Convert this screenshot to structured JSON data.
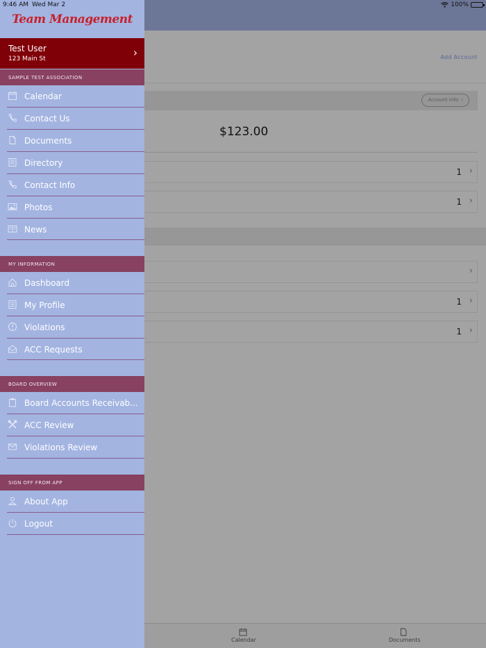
{
  "status_bar": {
    "time": "9:46 AM",
    "date": "Wed Mar 2",
    "battery": "100%"
  },
  "header": {
    "add_account": "Add Account"
  },
  "account_card": {
    "account_info_label": "Account Info",
    "balance": "$123.00"
  },
  "rows": [
    {
      "count": "1"
    },
    {
      "count": "1"
    },
    {
      "count": ""
    },
    {
      "count": "1"
    },
    {
      "count": "1"
    }
  ],
  "tabbar": {
    "tabs": [
      {
        "label": "Calendar",
        "icon": "calendar-icon"
      },
      {
        "label": "Documents",
        "icon": "document-icon"
      }
    ]
  },
  "drawer": {
    "logo": "Team Management",
    "user": {
      "name": "Test User",
      "address": "123 Main St"
    },
    "sections": [
      {
        "title": "SAMPLE TEST ASSOCIATION",
        "items": [
          {
            "label": "Calendar",
            "icon": "calendar-icon"
          },
          {
            "label": "Contact Us",
            "icon": "phone-icon"
          },
          {
            "label": "Documents",
            "icon": "document-icon"
          },
          {
            "label": "Directory",
            "icon": "directory-icon"
          },
          {
            "label": "Contact Info",
            "icon": "phone-icon"
          },
          {
            "label": "Photos",
            "icon": "photos-icon"
          },
          {
            "label": "News",
            "icon": "news-icon"
          }
        ]
      },
      {
        "title": "MY INFORMATION",
        "items": [
          {
            "label": "Dashboard",
            "icon": "home-icon"
          },
          {
            "label": "My Profile",
            "icon": "profile-icon"
          },
          {
            "label": "Violations",
            "icon": "alert-icon"
          },
          {
            "label": "ACC Requests",
            "icon": "envelope-open-icon"
          }
        ]
      },
      {
        "title": "BOARD OVERVIEW",
        "items": [
          {
            "label": "Board Accounts Receivab...",
            "icon": "clipboard-icon"
          },
          {
            "label": "ACC Review",
            "icon": "tools-icon"
          },
          {
            "label": "Violations Review",
            "icon": "envelope-icon"
          }
        ]
      },
      {
        "title": "SIGN OFF FROM APP",
        "items": [
          {
            "label": "About App",
            "icon": "person-icon"
          },
          {
            "label": "Logout",
            "icon": "power-icon"
          }
        ]
      }
    ]
  },
  "colors": {
    "drawer_bg": "#a3b4e1",
    "user_row": "#800008",
    "section_header": "#884160",
    "logo": "#c8202a"
  }
}
